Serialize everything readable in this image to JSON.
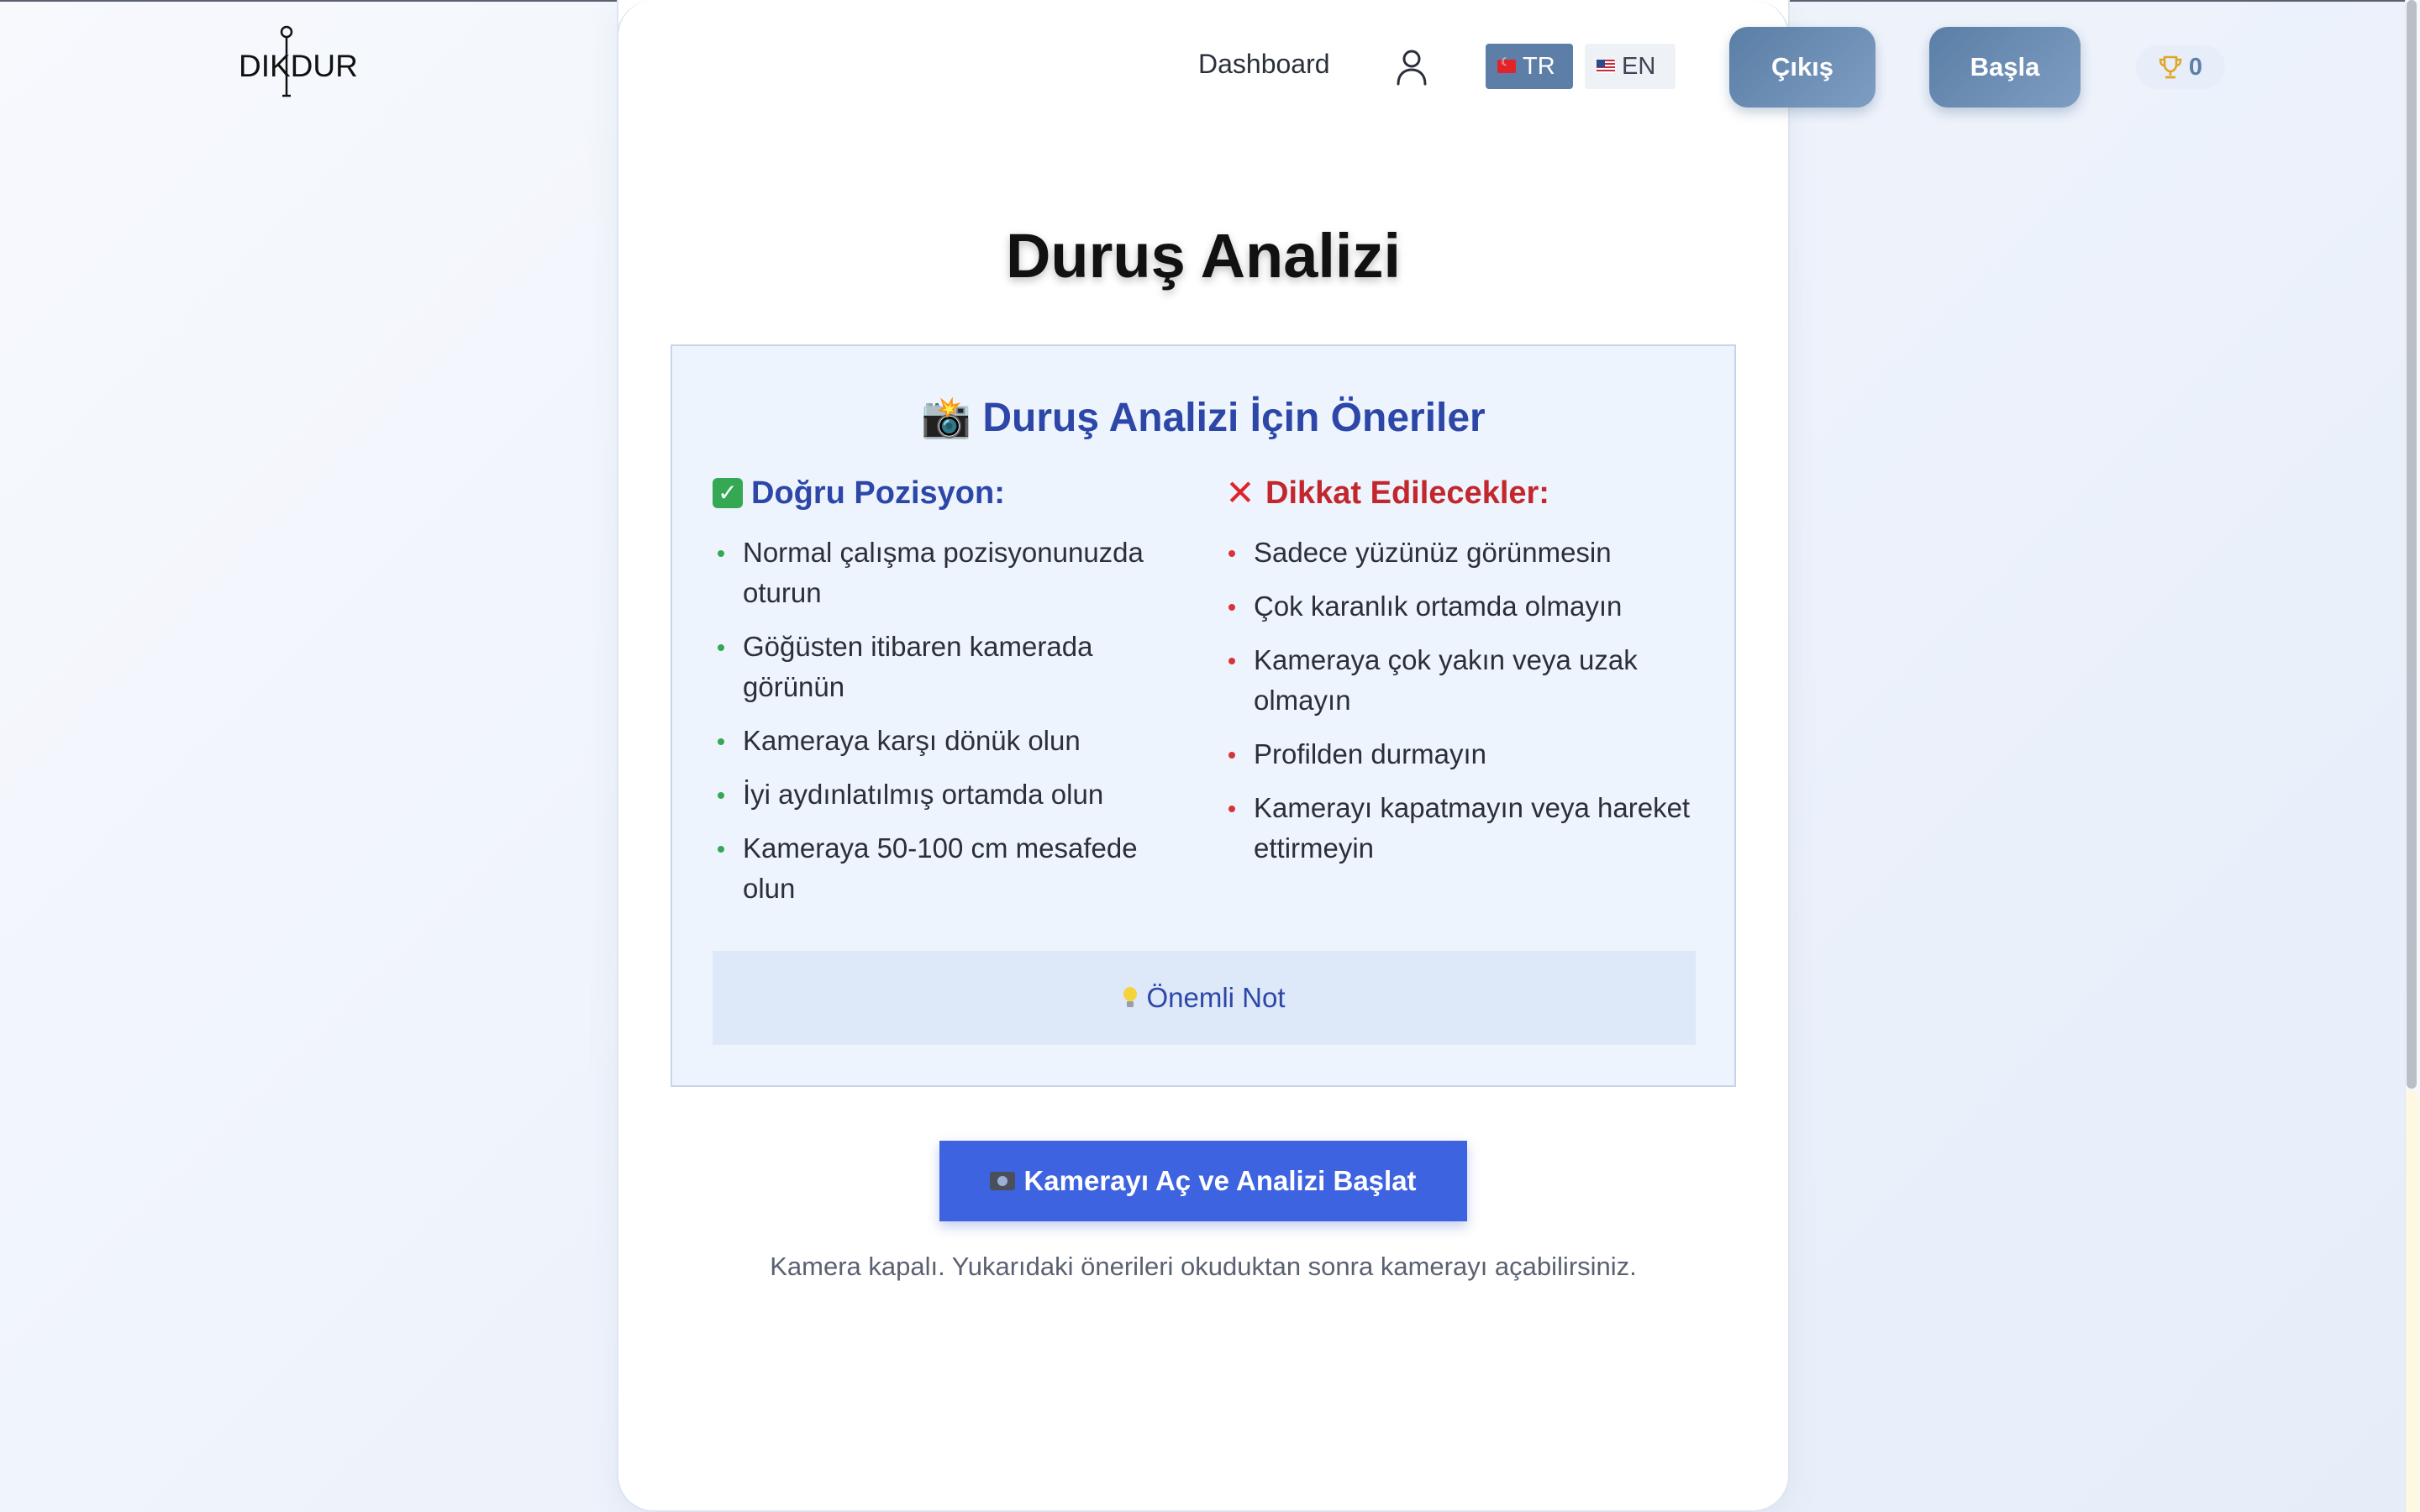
{
  "brand": {
    "logo_text": "DIKDUR"
  },
  "nav": {
    "dashboard_label": "Dashboard",
    "user_icon": "user-icon",
    "languages": [
      {
        "code": "TR",
        "flag": "tr-flag-icon",
        "active": true
      },
      {
        "code": "EN",
        "flag": "us-flag-icon",
        "active": false
      }
    ],
    "exit_label": "Çıkış",
    "start_label": "Başla",
    "score": "0"
  },
  "page": {
    "title": "Duruş Analizi",
    "recommendations": {
      "title": "Duruş Analizi İçin Öneriler",
      "title_emoji": "📸",
      "correct": {
        "heading": "Doğru Pozisyon:",
        "items": [
          "Normal çalışma pozisyonunuzda oturun",
          "Göğüsten itibaren kamerada görünün",
          "Kameraya karşı dönük olun",
          "İyi aydınlatılmış ortamda olun",
          "Kameraya 50-100 cm mesafede olun"
        ]
      },
      "avoid": {
        "heading": "Dikkat Edilecekler:",
        "items": [
          "Sadece yüzünüz görünmesin",
          "Çok karanlık ortamda olmayın",
          "Kameraya çok yakın veya uzak olmayın",
          "Profilden durmayın",
          "Kamerayı kapatmayın veya hareket ettirmeyin"
        ]
      },
      "note_label": "Önemli Not"
    },
    "camera_button_label": "Kamerayı Aç ve Analizi Başlat",
    "status_text": "Kamera kapalı. Yukarıdaki önerileri okuduktan sonra kamerayı açabilirsiniz."
  },
  "colors": {
    "primary": "#3d63e0",
    "nav_button": "#5a7ea6",
    "heading_blue": "#2d47a8",
    "heading_red": "#c2272d",
    "bullet_green": "#35a853",
    "bullet_red": "#d9333a",
    "box_bg": "#eef4fd",
    "note_bg": "#dde8f8"
  }
}
